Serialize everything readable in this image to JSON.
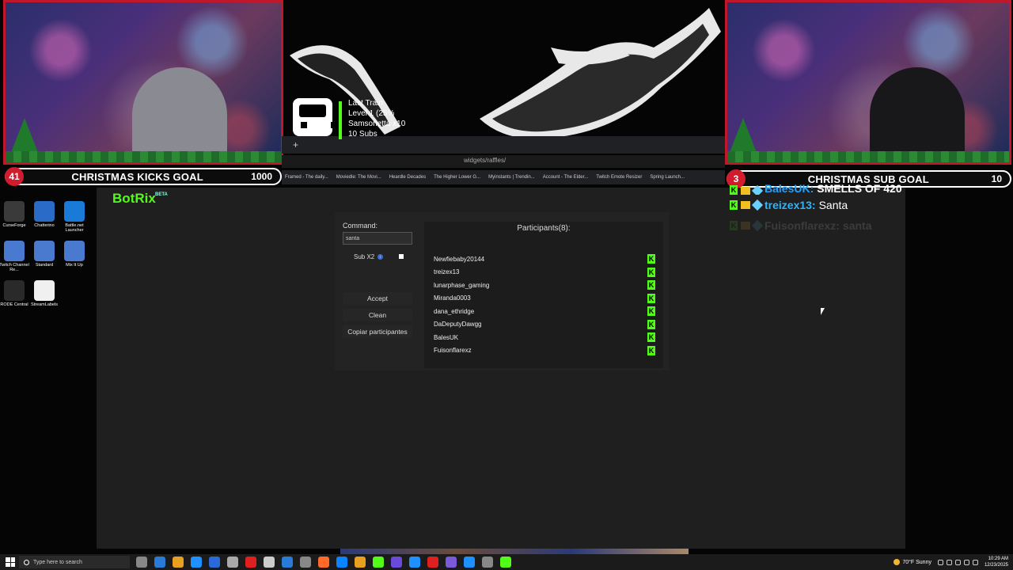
{
  "overlay": {
    "left_goal": {
      "current": "41",
      "title": "CHRISTMAS KICKS GOAL",
      "target": "1000"
    },
    "right_goal": {
      "current": "3",
      "title": "CHRISTMAS SUB GOAL",
      "target": "10"
    },
    "train": {
      "line1": "Last Train",
      "line2": "Level 1 (25%",
      "line3": "Samsonetta x10",
      "line4": "10 Subs"
    }
  },
  "browser": {
    "url_fragment": "widgets/raffles/",
    "bookmarks": [
      "Framed - The daily...",
      "Moviedle: The Movi...",
      "Heardle Decades",
      "The Higher Lower G...",
      "Myinstants | Trendin...",
      "Account - The Elder...",
      "Twitch Emote Resizer",
      "Spring Launch..."
    ]
  },
  "desktop_icons": [
    {
      "label": "CurseForge",
      "color": "#3a3a3a"
    },
    {
      "label": "Chatterino",
      "color": "#2a6bc8"
    },
    {
      "label": "Battle.net Launcher",
      "color": "#1a7ad8"
    },
    {
      "label": "Twitch Channel Re...",
      "color": "#4a7ad0"
    },
    {
      "label": "Standard",
      "color": "#4a7ad0"
    },
    {
      "label": "Mix It Up",
      "color": "#4a7ad0"
    },
    {
      "label": "RODE Central",
      "color": "#2a2a2a"
    },
    {
      "label": "StreamLabels",
      "color": "#f0f0f0"
    }
  ],
  "botrix": {
    "logo": "BotRix",
    "beta": "BETA",
    "command_label": "Command:",
    "command_value": "santa",
    "sub_label": "Sub X2",
    "sub_info": "i",
    "accept_label": "Accept",
    "clean_label": "Clean",
    "copy_label": "Copiar participantes",
    "participants_title": "Participants(8):",
    "participants": [
      "Newfiebaby20144",
      "treizex13",
      "lunarphase_gaming",
      "Miranda0003",
      "dana_ethridge",
      "DaDeputyDawgg",
      "BalesUK",
      "Fuisonflarexz"
    ],
    "badge": "K"
  },
  "chat": [
    {
      "user": "BalesUK:",
      "message": "SMELLS OF 420"
    },
    {
      "user": "treizex13:",
      "message": "Santa"
    },
    {
      "user": "Fuisonflarexz:",
      "message": "santa"
    }
  ],
  "taskbar": {
    "search_placeholder": "Type here to search",
    "weather": "70°F  Sunny",
    "time": "10:29 AM",
    "date": "12/23/2025",
    "app_colors": [
      "#888",
      "#2a7ad8",
      "#e8a020",
      "#1e90ff",
      "#2a6ad8",
      "#aaaaaa",
      "#e02020",
      "#cccccc",
      "#2a7ad8",
      "#888",
      "#ff6a2a",
      "#0a84ff",
      "#e8a020",
      "#53fc18",
      "#6a4ad8",
      "#1e90ff",
      "#e02020",
      "#7a5ad8",
      "#1e90ff",
      "#888888",
      "#53fc18"
    ]
  }
}
